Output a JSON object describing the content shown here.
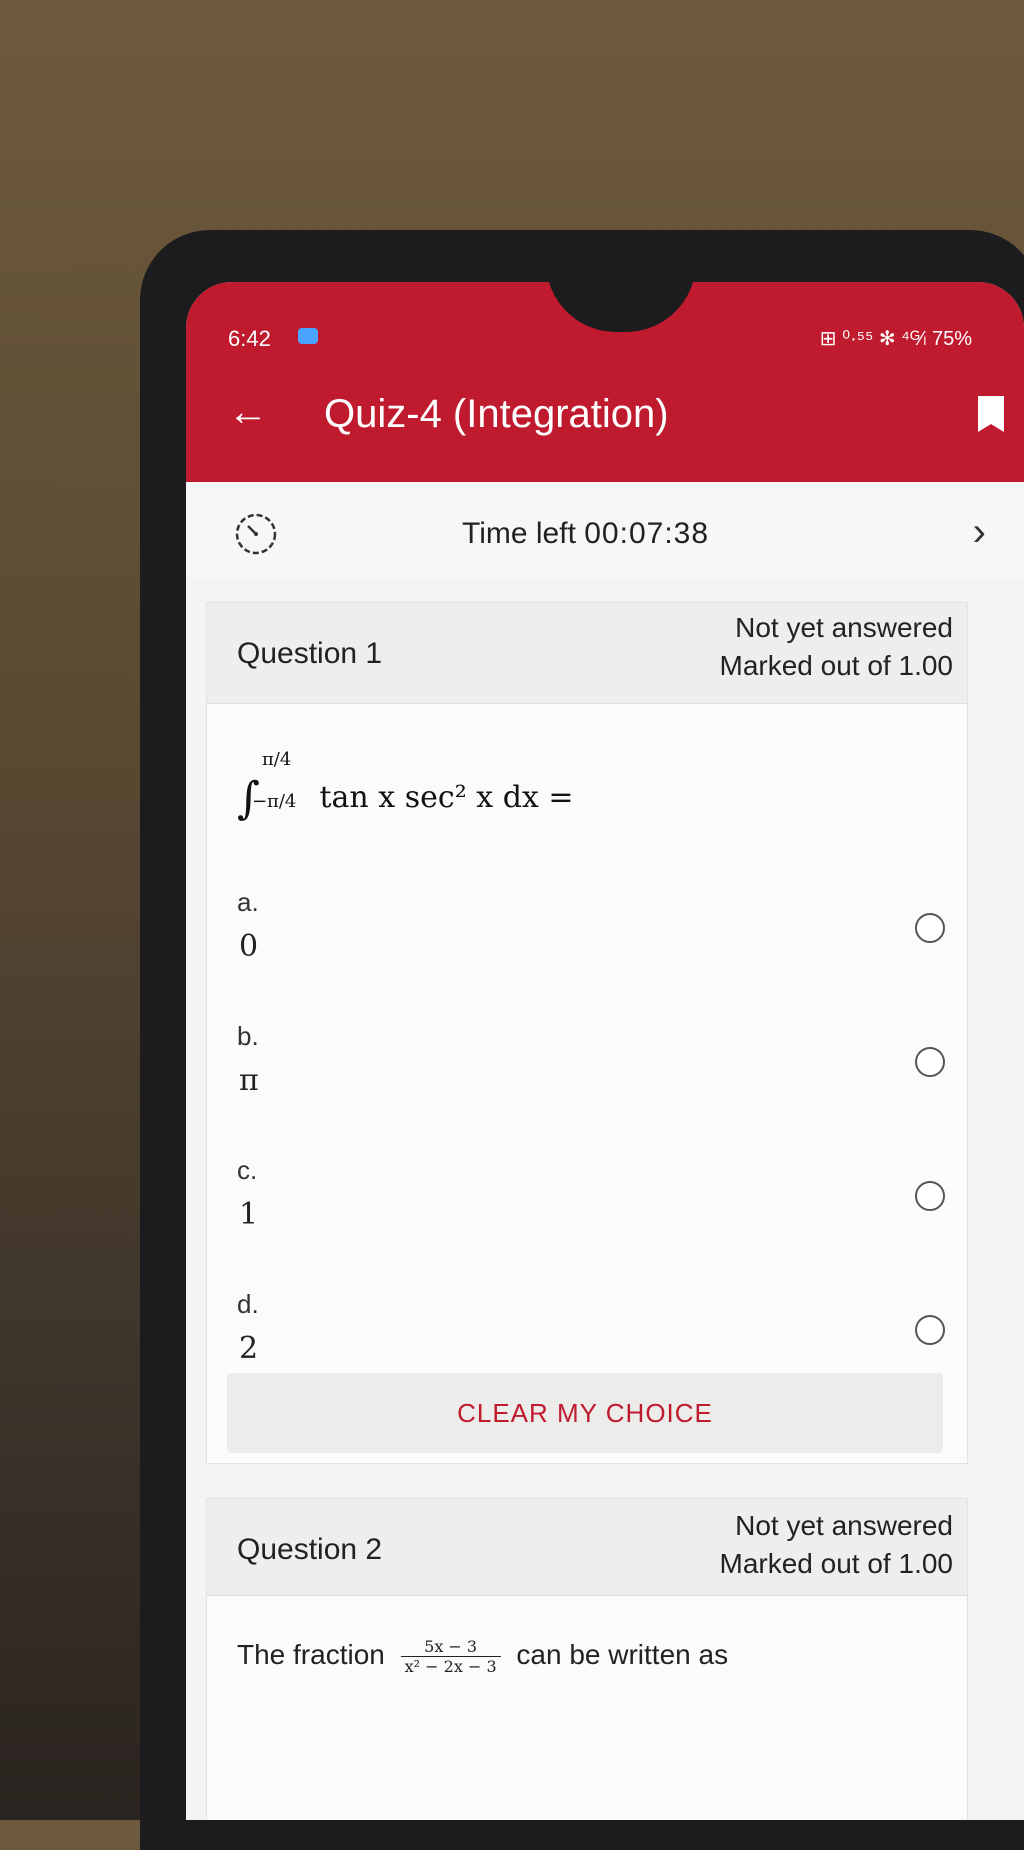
{
  "status_bar": {
    "time": "6:42",
    "right": "⊞ ⁰·⁵⁵ ✻ ⁴ᴳ⁄ₗ 75%"
  },
  "header": {
    "title": "Quiz-4 (Integration)",
    "back_icon": "arrow-left-icon",
    "bookmark_icon": "bookmark-icon"
  },
  "timer": {
    "label": "Time left ",
    "value": "00:07:38"
  },
  "question1": {
    "title": "Question 1",
    "status": "Not yet answered",
    "marks": "Marked out of 1.00",
    "formula": {
      "integral": "∫",
      "upper": "π/4",
      "lower": "−π/4",
      "body": "tan x sec² x dx ="
    },
    "options": [
      {
        "letter": "a.",
        "value": "0"
      },
      {
        "letter": "b.",
        "value": "π"
      },
      {
        "letter": "c.",
        "value": "1"
      },
      {
        "letter": "d.",
        "value": "2"
      }
    ],
    "clear_label": "CLEAR MY CHOICE"
  },
  "question2": {
    "title": "Question 2",
    "status": "Not yet answered",
    "marks": "Marked out of 1.00",
    "text_before": "The fraction",
    "numerator": "5x − 3",
    "denominator": "x² − 2x − 3",
    "text_after": "can be written as"
  },
  "colors": {
    "header": "#c01a2e",
    "accent_text": "#c01a2e"
  }
}
